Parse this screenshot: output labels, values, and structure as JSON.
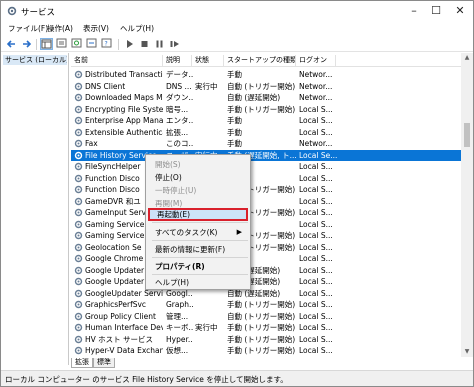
{
  "window": {
    "title": "サービス"
  },
  "menubar": [
    "ファイル(F)",
    "操作(A)",
    "表示(V)",
    "ヘルプ(H)"
  ],
  "toolbar_icons": [
    "back-arrow-icon",
    "forward-arrow-icon",
    "console-tree-icon",
    "properties-icon",
    "refresh-icon",
    "export-icon",
    "help-icon",
    "start-icon",
    "stop-icon",
    "pause-icon",
    "restart-icon"
  ],
  "tree": {
    "label": "サービス (ローカル)"
  },
  "columns": [
    "名前",
    "説明",
    "状態",
    "スタートアップの種類",
    "ログオン"
  ],
  "rows": [
    {
      "name": "Distributed Transactio...",
      "desc": "データ...",
      "status": "",
      "startup": "手動",
      "logon": "Networ..."
    },
    {
      "name": "DNS Client",
      "desc": "DNS ...",
      "status": "実行中",
      "startup": "自動 (トリガー開始)",
      "logon": "Networ..."
    },
    {
      "name": "Downloaded Maps M...",
      "desc": "ダウン...",
      "status": "",
      "startup": "自動 (遅延開始)",
      "logon": "Networ..."
    },
    {
      "name": "Encrypting File Syste...",
      "desc": "暗号...",
      "status": "",
      "startup": "手動 (トリガー開始)",
      "logon": "Local S..."
    },
    {
      "name": "Enterprise App Mana...",
      "desc": "エンタ...",
      "status": "",
      "startup": "手動",
      "logon": "Local S..."
    },
    {
      "name": "Extensible Authentica...",
      "desc": "拡張...",
      "status": "",
      "startup": "手動",
      "logon": "Local S..."
    },
    {
      "name": "Fax",
      "desc": "このコ...",
      "status": "",
      "startup": "手動",
      "logon": "Networ..."
    },
    {
      "name": "File History Service",
      "desc": "ユーザ...",
      "status": "実行中",
      "startup": "手動 (遅延開始, ト...",
      "logon": "Local Se..."
    },
    {
      "name": "FileSyncHelper",
      "desc": "",
      "status": "",
      "startup": "手動",
      "logon": "Local S..."
    },
    {
      "name": "Function Disco",
      "desc": "",
      "status": "",
      "startup": "手動",
      "logon": "Local S..."
    },
    {
      "name": "Function Disco",
      "desc": "",
      "status": "",
      "startup": "手動 (トリガー開始)",
      "logon": "Local S..."
    },
    {
      "name": "GameDVR 和ユ",
      "desc": "",
      "status": "",
      "startup": "手動",
      "logon": "Local S..."
    },
    {
      "name": "GameInput Serv",
      "desc": "",
      "status": "",
      "startup": "手動 (トリガー開始)",
      "logon": "Local S..."
    },
    {
      "name": "Gaming Service",
      "desc": "",
      "status": "",
      "startup": "手動",
      "logon": "Local S..."
    },
    {
      "name": "Gaming Service",
      "desc": "",
      "status": "",
      "startup": "自動 (トリガー開始)",
      "logon": "Local S..."
    },
    {
      "name": "Geolocation Se",
      "desc": "",
      "status": "",
      "startup": "手動 (トリガー開始)",
      "logon": "Local S..."
    },
    {
      "name": "Google Chrome",
      "desc": "",
      "status": "",
      "startup": "手動",
      "logon": "Local S..."
    },
    {
      "name": "Google Updater",
      "desc": "",
      "status": "",
      "startup": "自動 (遅延開始)",
      "logon": "Local S..."
    },
    {
      "name": "Google Updater",
      "desc": "",
      "status": "",
      "startup": "自動 (遅延開始)",
      "logon": "Local S..."
    },
    {
      "name": "GoogleUpdater Service...",
      "desc": "Googl...",
      "status": "",
      "startup": "自動 (遅延開始)",
      "logon": "Local S..."
    },
    {
      "name": "GraphicsPerfSvc",
      "desc": "Graph...",
      "status": "",
      "startup": "手動 (トリガー開始)",
      "logon": "Local S..."
    },
    {
      "name": "Group Policy Client",
      "desc": "管理...",
      "status": "",
      "startup": "自動 (トリガー開始)",
      "logon": "Local S..."
    },
    {
      "name": "Human Interface Devi...",
      "desc": "キーボ...",
      "status": "実行中",
      "startup": "手動 (トリガー開始)",
      "logon": "Local S..."
    },
    {
      "name": "HV ホスト サービス",
      "desc": "Hyper...",
      "status": "",
      "startup": "手動 (トリガー開始)",
      "logon": "Local S..."
    },
    {
      "name": "Hyper-V Data Exchan...",
      "desc": "仮想...",
      "status": "",
      "startup": "手動 (トリガー開始)",
      "logon": "Local S..."
    }
  ],
  "selected_row": 7,
  "context_menu": [
    {
      "label": "開始(S)",
      "disabled": true
    },
    {
      "label": "停止(O)",
      "disabled": false
    },
    {
      "label": "一時停止(U)",
      "disabled": true
    },
    {
      "label": "再開(M)",
      "disabled": true
    },
    {
      "label": "再起動(E)",
      "disabled": false,
      "highlighted": true
    },
    {
      "label": "すべてのタスク(K)",
      "disabled": false,
      "submenu": true
    },
    {
      "label": "最新の情報に更新(F)",
      "disabled": false
    },
    {
      "label": "プロパティ(R)",
      "disabled": false,
      "bold": true
    },
    {
      "label": "ヘルプ(H)",
      "disabled": false
    }
  ],
  "tabs": [
    "拡張",
    "標準"
  ],
  "statusbar": {
    "text": "ローカル コンピューター のサービス File History Service を停止して開始します。"
  },
  "colors": {
    "selection": "#0a75d6",
    "highlight_border": "#d9202c",
    "menu_hover": "#cde3f8"
  }
}
